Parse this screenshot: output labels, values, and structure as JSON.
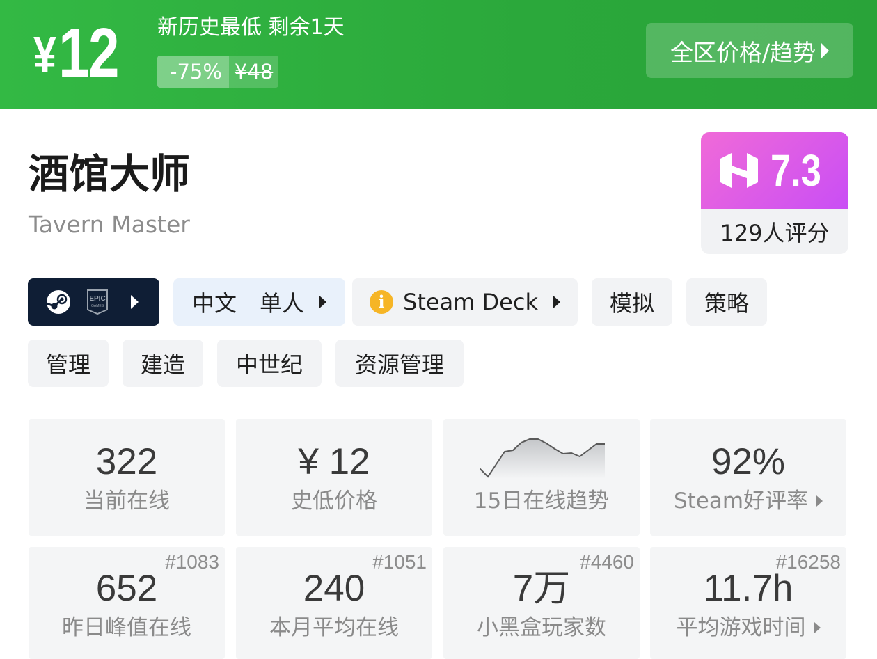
{
  "deal": {
    "current_price": "12",
    "currency_symbol": "¥",
    "headline": "新历史最低 剩余1天",
    "discount": "-75%",
    "original_price": "¥48",
    "trend_button": "全区价格/趋势"
  },
  "game": {
    "title_cn": "酒馆大师",
    "title_en": "Tavern Master"
  },
  "score": {
    "value": "7.3",
    "count_label": "129人评分"
  },
  "tags": {
    "stores": [
      "steam-icon",
      "epic-games-icon"
    ],
    "language": "中文",
    "players": "单人",
    "steam_deck": "Steam Deck",
    "genres_row1": [
      "模拟",
      "策略"
    ],
    "genres_row2": [
      "管理",
      "建造",
      "中世纪",
      "资源管理"
    ]
  },
  "stats": {
    "current_online": {
      "value": "322",
      "label": "当前在线"
    },
    "lowest_price": {
      "value": "¥ 12",
      "label": "史低价格"
    },
    "trend": {
      "label": "15日在线趋势",
      "points": [
        294,
        282,
        300,
        318,
        320,
        331,
        336,
        336,
        330,
        322,
        315,
        316,
        311,
        320,
        329,
        329
      ]
    },
    "steam_rating": {
      "value": "92%",
      "label": "Steam好评率"
    },
    "peak_yesterday": {
      "value": "652",
      "label": "昨日峰值在线",
      "rank": "#1083"
    },
    "monthly_avg": {
      "value": "240",
      "label": "本月平均在线",
      "rank": "#1051"
    },
    "xhh_players": {
      "value": "7万",
      "label": "小黑盒玩家数",
      "rank": "#4460"
    },
    "avg_playtime": {
      "value": "11.7h",
      "label": "平均游戏时间",
      "rank": "#16258"
    }
  },
  "colors": {
    "banner_green": "#2ba83b",
    "score_gradient_start": "#f06ad8",
    "score_gradient_end": "#c94ef5",
    "store_chip_bg": "#0f1e35",
    "lang_chip_bg": "#e9f1fb",
    "deck_warning": "#f6b526"
  }
}
